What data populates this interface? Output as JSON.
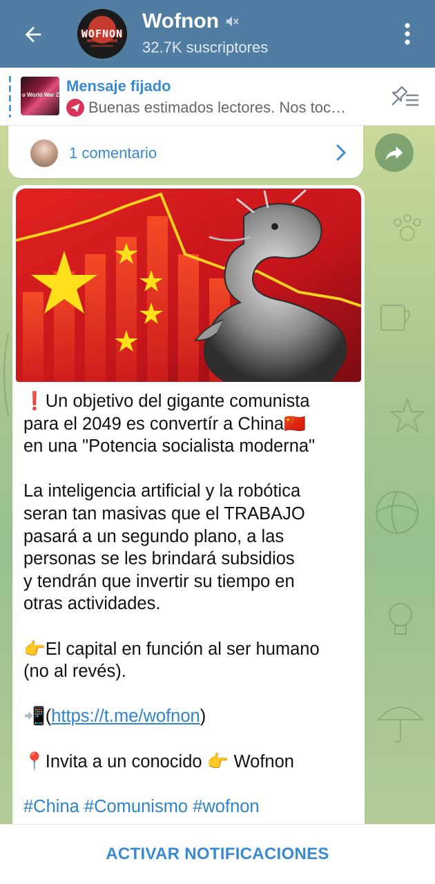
{
  "header": {
    "channel_name": "Wofnon",
    "subscribers": "32.7K suscriptores",
    "avatar_logo_text": "WOFNON",
    "muted": true
  },
  "pinned": {
    "title": "Mensaje fijado",
    "preview": "Buenas estimados lectores.  Nos toc…",
    "thumb_text": "o World War Zo"
  },
  "comments": {
    "label": "1 comentario"
  },
  "message": {
    "lines": [
      {
        "type": "text",
        "emoji": "❗",
        "text": "Un objetivo del gigante comunista"
      },
      {
        "type": "text",
        "text": "para el 2049 es convertír a China",
        "emoji_after": "🇨🇳"
      },
      {
        "type": "text",
        "text": "en una \"Potencia socialista moderna\""
      },
      {
        "type": "gap"
      },
      {
        "type": "text",
        "text": "La inteligencia artificial y la robótica"
      },
      {
        "type": "text",
        "text": "seran tan masivas que el TRABAJO"
      },
      {
        "type": "text",
        "text": "pasará a un segundo plano, a las"
      },
      {
        "type": "text",
        "text": "personas se les brindará subsidios"
      },
      {
        "type": "text",
        "text": "y tendrán que invertir su tiempo en"
      },
      {
        "type": "text",
        "text": "otras actividades."
      },
      {
        "type": "gap"
      },
      {
        "type": "text",
        "emoji": "👉",
        "text": "El capital en función al ser humano"
      },
      {
        "type": "text",
        "text": "(no al revés)."
      },
      {
        "type": "gap"
      },
      {
        "type": "link",
        "emoji": "📲",
        "prefix": "(",
        "link": "https://t.me/wofnon",
        "suffix": ")"
      },
      {
        "type": "gap"
      },
      {
        "type": "text",
        "emoji": "📍",
        "text": "Invita a un conocido ",
        "emoji_after": "👉",
        "text_after": " Wofnon"
      },
      {
        "type": "gap"
      },
      {
        "type": "tags",
        "text": "#China #Comunismo #wofnon"
      }
    ]
  },
  "bottom": {
    "action_label": "ACTIVAR NOTIFICACIONES"
  },
  "colors": {
    "header_bg": "#527da3",
    "accent_blue": "#3a8ad1",
    "link_blue": "#2f83c8"
  },
  "icons": {
    "back": "arrow-left-icon",
    "mute": "muted-speaker-icon",
    "menu": "more-vertical-icon",
    "pin_list": "pinned-list-icon",
    "chevron": "chevron-right-icon",
    "share": "share-arrow-icon"
  }
}
